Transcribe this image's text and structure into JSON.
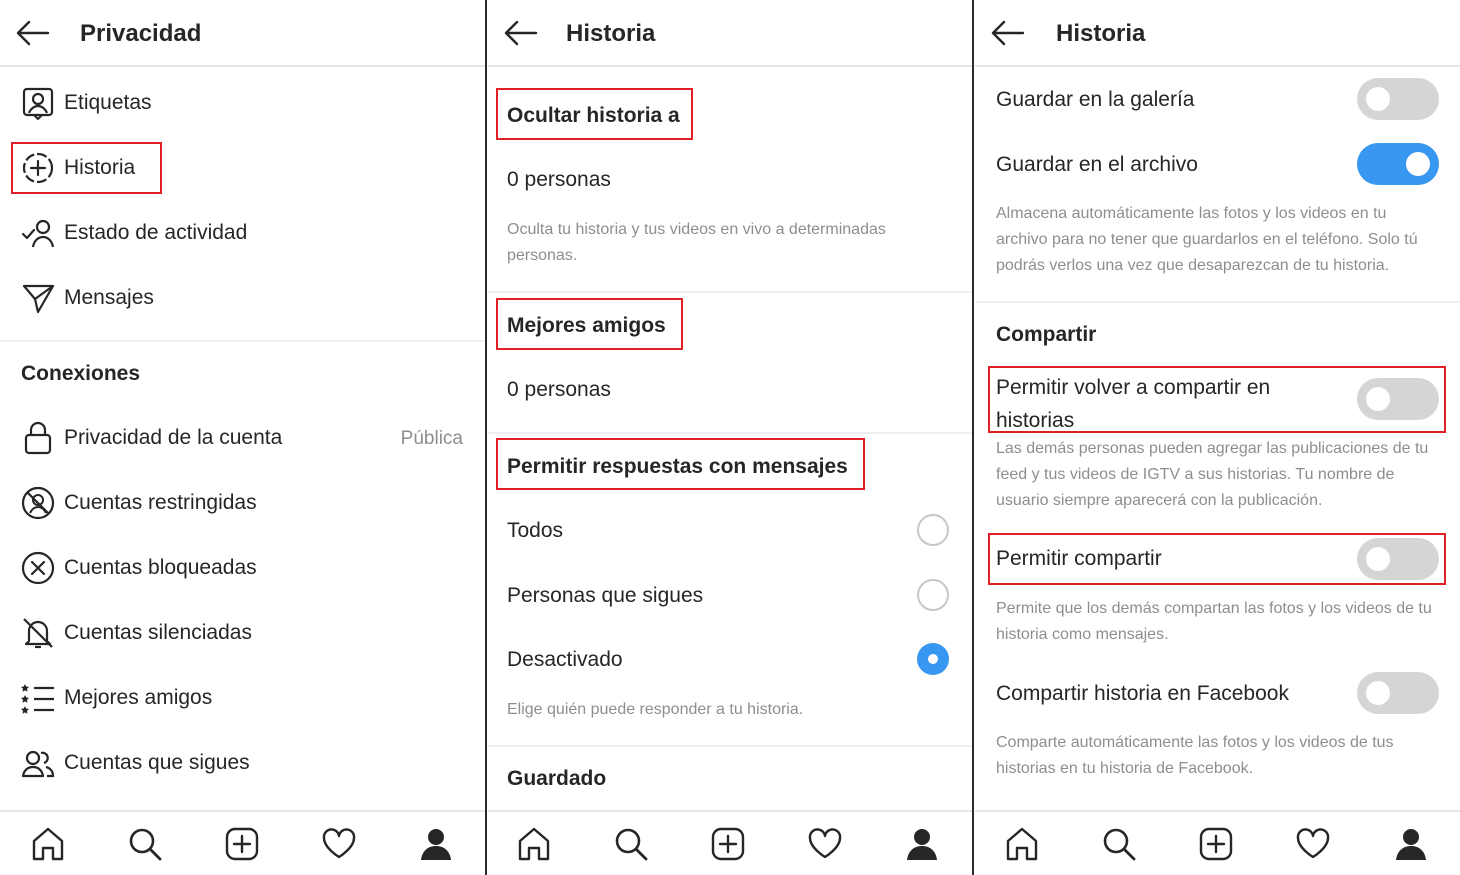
{
  "panel1": {
    "title": "Privacidad",
    "items_top": [
      {
        "label": "Etiquetas",
        "icon": "tag-person-icon"
      },
      {
        "label": "Historia",
        "icon": "story-add-icon"
      },
      {
        "label": "Estado de actividad",
        "icon": "activity-status-icon"
      },
      {
        "label": "Mensajes",
        "icon": "paper-plane-icon"
      }
    ],
    "section": "Conexiones",
    "items_conn": [
      {
        "label": "Privacidad de la cuenta",
        "icon": "lock-icon",
        "value": "Pública"
      },
      {
        "label": "Cuentas restringidas",
        "icon": "restricted-icon"
      },
      {
        "label": "Cuentas bloqueadas",
        "icon": "blocked-icon"
      },
      {
        "label": "Cuentas silenciadas",
        "icon": "muted-bell-icon"
      },
      {
        "label": "Mejores amigos",
        "icon": "close-friends-list-icon"
      },
      {
        "label": "Cuentas que sigues",
        "icon": "following-icon"
      }
    ]
  },
  "panel2": {
    "title": "Historia",
    "hide_story": {
      "heading": "Ocultar historia a",
      "count": "0 personas",
      "description": "Oculta tu historia y tus videos en vivo a determinadas personas."
    },
    "close_friends": {
      "heading": "Mejores amigos",
      "count": "0 personas"
    },
    "replies": {
      "heading": "Permitir respuestas con mensajes",
      "options": [
        {
          "label": "Todos",
          "selected": false
        },
        {
          "label": "Personas que sigues",
          "selected": false
        },
        {
          "label": "Desactivado",
          "selected": true
        }
      ],
      "description": "Elige quién puede responder a tu historia."
    },
    "saving_heading": "Guardado"
  },
  "panel3": {
    "title": "Historia",
    "save_gallery": {
      "label": "Guardar en la galería",
      "on": false
    },
    "save_archive": {
      "label": "Guardar en el archivo",
      "on": true
    },
    "archive_description": "Almacena automáticamente las fotos y los videos en tu archivo para no tener que guardarlos en el teléfono. Solo tú podrás verlos una vez que desaparezcan de tu historia.",
    "share_section": "Compartir",
    "allow_reshare": {
      "label": "Permitir volver a compartir en historias",
      "on": false,
      "description": "Las demás personas pueden agregar las publicaciones de tu feed y tus videos de IGTV a sus historias. Tu nombre de usuario siempre aparecerá con la publicación."
    },
    "allow_sharing": {
      "label": "Permitir compartir",
      "on": false,
      "description": "Permite que los demás compartan las fotos y los videos de tu historia como mensajes."
    },
    "share_facebook": {
      "label": "Compartir historia en Facebook",
      "on": false,
      "description": "Comparte automáticamente las fotos y los videos de tus historias en tu historia de Facebook."
    }
  },
  "bottom_nav": [
    "home-icon",
    "search-icon",
    "new-post-icon",
    "activity-heart-icon",
    "profile-icon"
  ],
  "colors": {
    "accent": "#3897f0",
    "highlight": "#e01f26",
    "toggle_off": "#d5d5d5",
    "secondary_text": "#8e8e8e"
  }
}
